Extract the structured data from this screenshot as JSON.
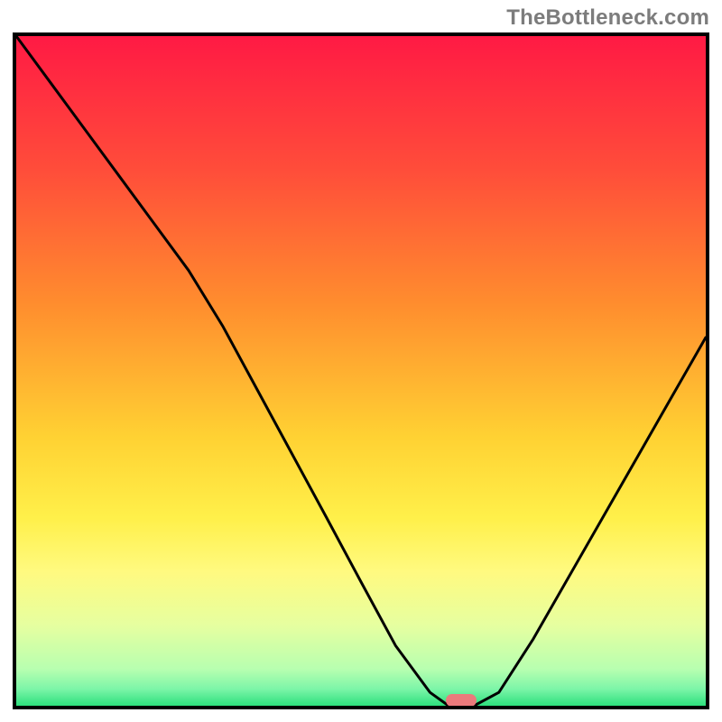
{
  "watermark": {
    "text": "TheBottleneck.com"
  },
  "chart_data": {
    "type": "line",
    "title": "",
    "xlabel": "",
    "ylabel": "",
    "xlim": [
      0,
      100
    ],
    "ylim": [
      0,
      100
    ],
    "grid": false,
    "legend": false,
    "background_gradient_stops": [
      {
        "offset": 0.0,
        "color": "#ff1a44"
      },
      {
        "offset": 0.2,
        "color": "#ff4d3a"
      },
      {
        "offset": 0.4,
        "color": "#ff8d2e"
      },
      {
        "offset": 0.6,
        "color": "#ffd233"
      },
      {
        "offset": 0.72,
        "color": "#fff04a"
      },
      {
        "offset": 0.8,
        "color": "#fffa80"
      },
      {
        "offset": 0.88,
        "color": "#e6ffa0"
      },
      {
        "offset": 0.945,
        "color": "#b8ffb0"
      },
      {
        "offset": 0.975,
        "color": "#7cf5a8"
      },
      {
        "offset": 1.0,
        "color": "#2de07d"
      }
    ],
    "series": [
      {
        "name": "bottleneck-curve",
        "color": "#000000",
        "stroke_width": 3,
        "x": [
          0,
          5,
          10,
          15,
          20,
          25,
          30,
          35,
          40,
          45,
          50,
          55,
          60,
          62.7,
          66.4,
          70,
          75,
          80,
          85,
          90,
          95,
          100
        ],
        "y": [
          100,
          93,
          86,
          79,
          72,
          65,
          56.6,
          47.1,
          37.6,
          28.1,
          18.5,
          9,
          2,
          0,
          0,
          2,
          10,
          19,
          28,
          37,
          46,
          55
        ]
      }
    ],
    "marker": {
      "name": "optimal-marker",
      "color": "#eb7a7c",
      "x": 64.5,
      "y": 0.8
    }
  }
}
